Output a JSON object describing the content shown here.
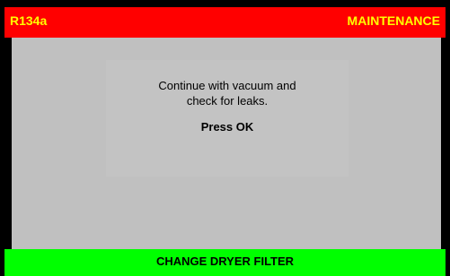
{
  "header": {
    "refrigerant_label": "R134a",
    "mode_label": "MAINTENANCE"
  },
  "message": {
    "line1": "Continue with vacuum and",
    "line2": "check for leaks.",
    "prompt": "Press OK"
  },
  "footer": {
    "label": "CHANGE DRYER FILTER"
  },
  "colors": {
    "header_background": "#ff0000",
    "header_text": "#ffff00",
    "body_background": "#c0c0c0",
    "footer_background": "#00ff00",
    "frame": "#000000"
  }
}
